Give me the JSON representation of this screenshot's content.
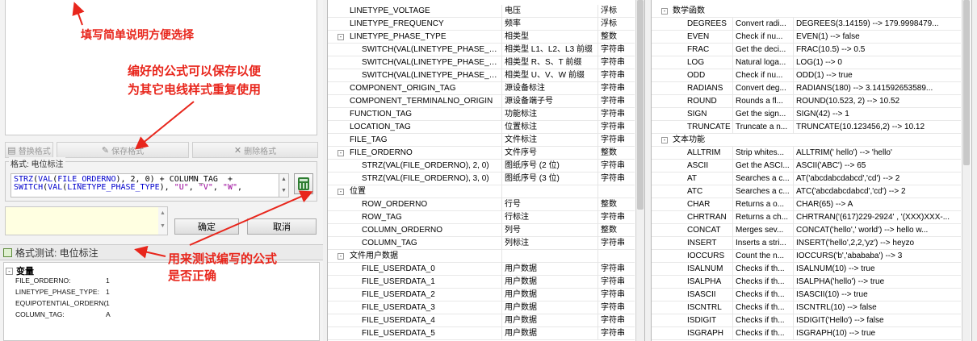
{
  "left_panel": {
    "toolbar": {
      "replace_label": "替换格式",
      "save_label": "保存格式",
      "delete_label": "删除格式"
    },
    "format_group_label": "格式: 电位标注",
    "formula_lines": [
      [
        [
          "STRZ",
          "fn"
        ],
        [
          "(",
          "kw"
        ],
        [
          "VAL",
          "fn"
        ],
        [
          "(",
          "kw"
        ],
        [
          "FILE_ORDERNO",
          "fn"
        ],
        [
          "), 2, 0) + COLUMN_TAG  +",
          "kw"
        ]
      ],
      [
        [
          "SWITCH",
          "fn"
        ],
        [
          "(",
          "kw"
        ],
        [
          "VAL",
          "fn"
        ],
        [
          "(",
          "kw"
        ],
        [
          "LINETYPE_PHASE_TYPE",
          "fn"
        ],
        [
          "), ",
          "kw"
        ],
        [
          "\"U\"",
          "str"
        ],
        [
          ", ",
          "kw"
        ],
        [
          "\"V\"",
          "str"
        ],
        [
          ", ",
          "kw"
        ],
        [
          "\"W\"",
          "str"
        ],
        [
          ",",
          "kw"
        ]
      ]
    ],
    "ok_label": "确定",
    "cancel_label": "取消",
    "test_title": "格式测试: 电位标注",
    "variables_label": "变量",
    "variables": [
      {
        "name": "FILE_ORDERNO:",
        "value": "1"
      },
      {
        "name": "LINETYPE_PHASE_TYPE:",
        "value": "1"
      },
      {
        "name": "EQUIPOTENTIAL_ORDERN(",
        "value": "1"
      },
      {
        "name": "COLUMN_TAG:",
        "value": "A"
      }
    ]
  },
  "annotations": {
    "hint_select": "填写简单说明方便选择",
    "hint_save_line1": "编好的公式可以保存以便",
    "hint_save_line2": "为其它电线样式重复使用",
    "hint_test_line1": "用来测试编写的公式",
    "hint_test_line2": "是否正确"
  },
  "attributes_grid": {
    "rows": [
      {
        "level": 0,
        "name": "LINETYPE_VOLTAGE",
        "desc": "电压",
        "type": "浮标"
      },
      {
        "level": 0,
        "name": "LINETYPE_FREQUENCY",
        "desc": "频率",
        "type": "浮标"
      },
      {
        "level": 0,
        "group": true,
        "expander": "-",
        "name": "LINETYPE_PHASE_TYPE",
        "desc": "相类型",
        "type": "整数"
      },
      {
        "level": 1,
        "name": "SWITCH(VAL(LINETYPE_PHASE_TYP...",
        "desc": "相类型 L1、L2、L3 前缀",
        "type": "字符串"
      },
      {
        "level": 1,
        "name": "SWITCH(VAL(LINETYPE_PHASE_TYP...",
        "desc": "相类型 R、S、T 前缀",
        "type": "字符串"
      },
      {
        "level": 1,
        "name": "SWITCH(VAL(LINETYPE_PHASE_TYP...",
        "desc": "相类型 U、V、W 前缀",
        "type": "字符串"
      },
      {
        "level": 0,
        "name": "COMPONENT_ORIGIN_TAG",
        "desc": "源设备标注",
        "type": "字符串"
      },
      {
        "level": 0,
        "name": "COMPONENT_TERMINALNO_ORIGIN",
        "desc": "源设备端子号",
        "type": "字符串"
      },
      {
        "level": 0,
        "name": "FUNCTION_TAG",
        "desc": "功能标注",
        "type": "字符串"
      },
      {
        "level": 0,
        "name": "LOCATION_TAG",
        "desc": "位置标注",
        "type": "字符串"
      },
      {
        "level": 0,
        "name": "FILE_TAG",
        "desc": "文件标注",
        "type": "字符串"
      },
      {
        "level": 0,
        "group": true,
        "expander": "-",
        "name": "FILE_ORDERNO",
        "desc": "文件序号",
        "type": "整数"
      },
      {
        "level": 1,
        "name": "STRZ(VAL(FILE_ORDERNO), 2, 0)",
        "desc": "图纸序号 (2 位)",
        "type": "字符串"
      },
      {
        "level": 1,
        "name": "STRZ(VAL(FILE_ORDERNO), 3, 0)",
        "desc": "图纸序号 (3 位)",
        "type": "字符串"
      },
      {
        "level": 0,
        "group": true,
        "expander": "-",
        "name": "位置",
        "desc": "",
        "type": ""
      },
      {
        "level": 1,
        "name": "ROW_ORDERNO",
        "desc": "行号",
        "type": "整数"
      },
      {
        "level": 1,
        "name": "ROW_TAG",
        "desc": "行标注",
        "type": "字符串"
      },
      {
        "level": 1,
        "name": "COLUMN_ORDERNO",
        "desc": "列号",
        "type": "整数"
      },
      {
        "level": 1,
        "name": "COLUMN_TAG",
        "desc": "列标注",
        "type": "字符串"
      },
      {
        "level": 0,
        "group": true,
        "expander": "-",
        "name": "文件用户数据",
        "desc": "",
        "type": ""
      },
      {
        "level": 1,
        "name": "FILE_USERDATA_0",
        "desc": "用户数据",
        "type": "字符串"
      },
      {
        "level": 1,
        "name": "FILE_USERDATA_1",
        "desc": "用户数据",
        "type": "字符串"
      },
      {
        "level": 1,
        "name": "FILE_USERDATA_2",
        "desc": "用户数据",
        "type": "字符串"
      },
      {
        "level": 1,
        "name": "FILE_USERDATA_3",
        "desc": "用户数据",
        "type": "字符串"
      },
      {
        "level": 1,
        "name": "FILE_USERDATA_4",
        "desc": "用户数据",
        "type": "字符串"
      },
      {
        "level": 1,
        "name": "FILE_USERDATA_5",
        "desc": "用户数据",
        "type": "字符串"
      }
    ]
  },
  "functions_grid": {
    "rows": [
      {
        "group": true,
        "expander": "-",
        "name": "数学函数"
      },
      {
        "name": "DEGREES",
        "desc": "Convert radi...",
        "example": "DEGREES(3.14159)    --> 179.9998479..."
      },
      {
        "name": "EVEN",
        "desc": "Check if nu...",
        "example": "EVEN(1)     --> false"
      },
      {
        "name": "FRAC",
        "desc": "Get the deci...",
        "example": "FRAC(10.5)     --> 0.5"
      },
      {
        "name": "LOG",
        "desc": "Natural loga...",
        "example": "LOG(1)     --> 0"
      },
      {
        "name": "ODD",
        "desc": "Check if nu...",
        "example": "ODD(1)     --> true"
      },
      {
        "name": "RADIANS",
        "desc": "Convert deg...",
        "example": "RADIANS(180)     --> 3.141592653589..."
      },
      {
        "name": "ROUND",
        "desc": "Rounds a fl...",
        "example": "ROUND(10.523, 2)     --> 10.52"
      },
      {
        "name": "SIGN",
        "desc": "Get the sign...",
        "example": "SIGN(42)     --> 1"
      },
      {
        "name": "TRUNCATE",
        "desc": "Truncate a n...",
        "example": "TRUNCATE(10.123456,2)     --> 10.12"
      },
      {
        "group": true,
        "expander": "-",
        "name": "文本功能"
      },
      {
        "name": "ALLTRIM",
        "desc": "Strip whites...",
        "example": "ALLTRIM('   hello')     --> 'hello'"
      },
      {
        "name": "ASCII",
        "desc": "Get the ASCI...",
        "example": "ASCII('ABC')     --> 65"
      },
      {
        "name": "AT",
        "desc": "Searches a c...",
        "example": "AT('abcdabcdabcd','cd')     --> 2"
      },
      {
        "name": "ATC",
        "desc": "Searches a c...",
        "example": "ATC('abcdabcdabcd','cd')     --> 2"
      },
      {
        "name": "CHAR",
        "desc": "Returns a o...",
        "example": "CHAR(65)     --> A"
      },
      {
        "name": "CHRTRAN",
        "desc": "Returns a ch...",
        "example": "CHRTRAN('(617)229-2924' , '(XXX)XXX-..."
      },
      {
        "name": "CONCAT",
        "desc": "Merges sev...",
        "example": "CONCAT('hello',' world')     --> hello w..."
      },
      {
        "name": "INSERT",
        "desc": "Inserts a stri...",
        "example": "INSERT('hello',2,2,'yz')     --> heyzo"
      },
      {
        "name": "IOCCURS",
        "desc": "Count the n...",
        "example": "IOCCURS('b','abababa')     --> 3"
      },
      {
        "name": "ISALNUM",
        "desc": "Checks if th...",
        "example": "ISALNUM(10)     --> true"
      },
      {
        "name": "ISALPHA",
        "desc": "Checks if th...",
        "example": "ISALPHA('hello')     --> true"
      },
      {
        "name": "ISASCII",
        "desc": "Checks if th...",
        "example": "ISASCII(10)     --> true"
      },
      {
        "name": "ISCNTRL",
        "desc": "Checks if th...",
        "example": "ISCNTRL(10)     --> false"
      },
      {
        "name": "ISDIGIT",
        "desc": "Checks if th...",
        "example": "ISDIGIT('Hello')     --> false"
      },
      {
        "name": "ISGRAPH",
        "desc": "Checks if th...",
        "example": "ISGRAPH(10)     --> true"
      }
    ]
  },
  "colors": {
    "annotation": "#e8261c",
    "formula_fn": "#0000cc",
    "formula_string": "#990099",
    "description_bg": "#ffffe1"
  }
}
